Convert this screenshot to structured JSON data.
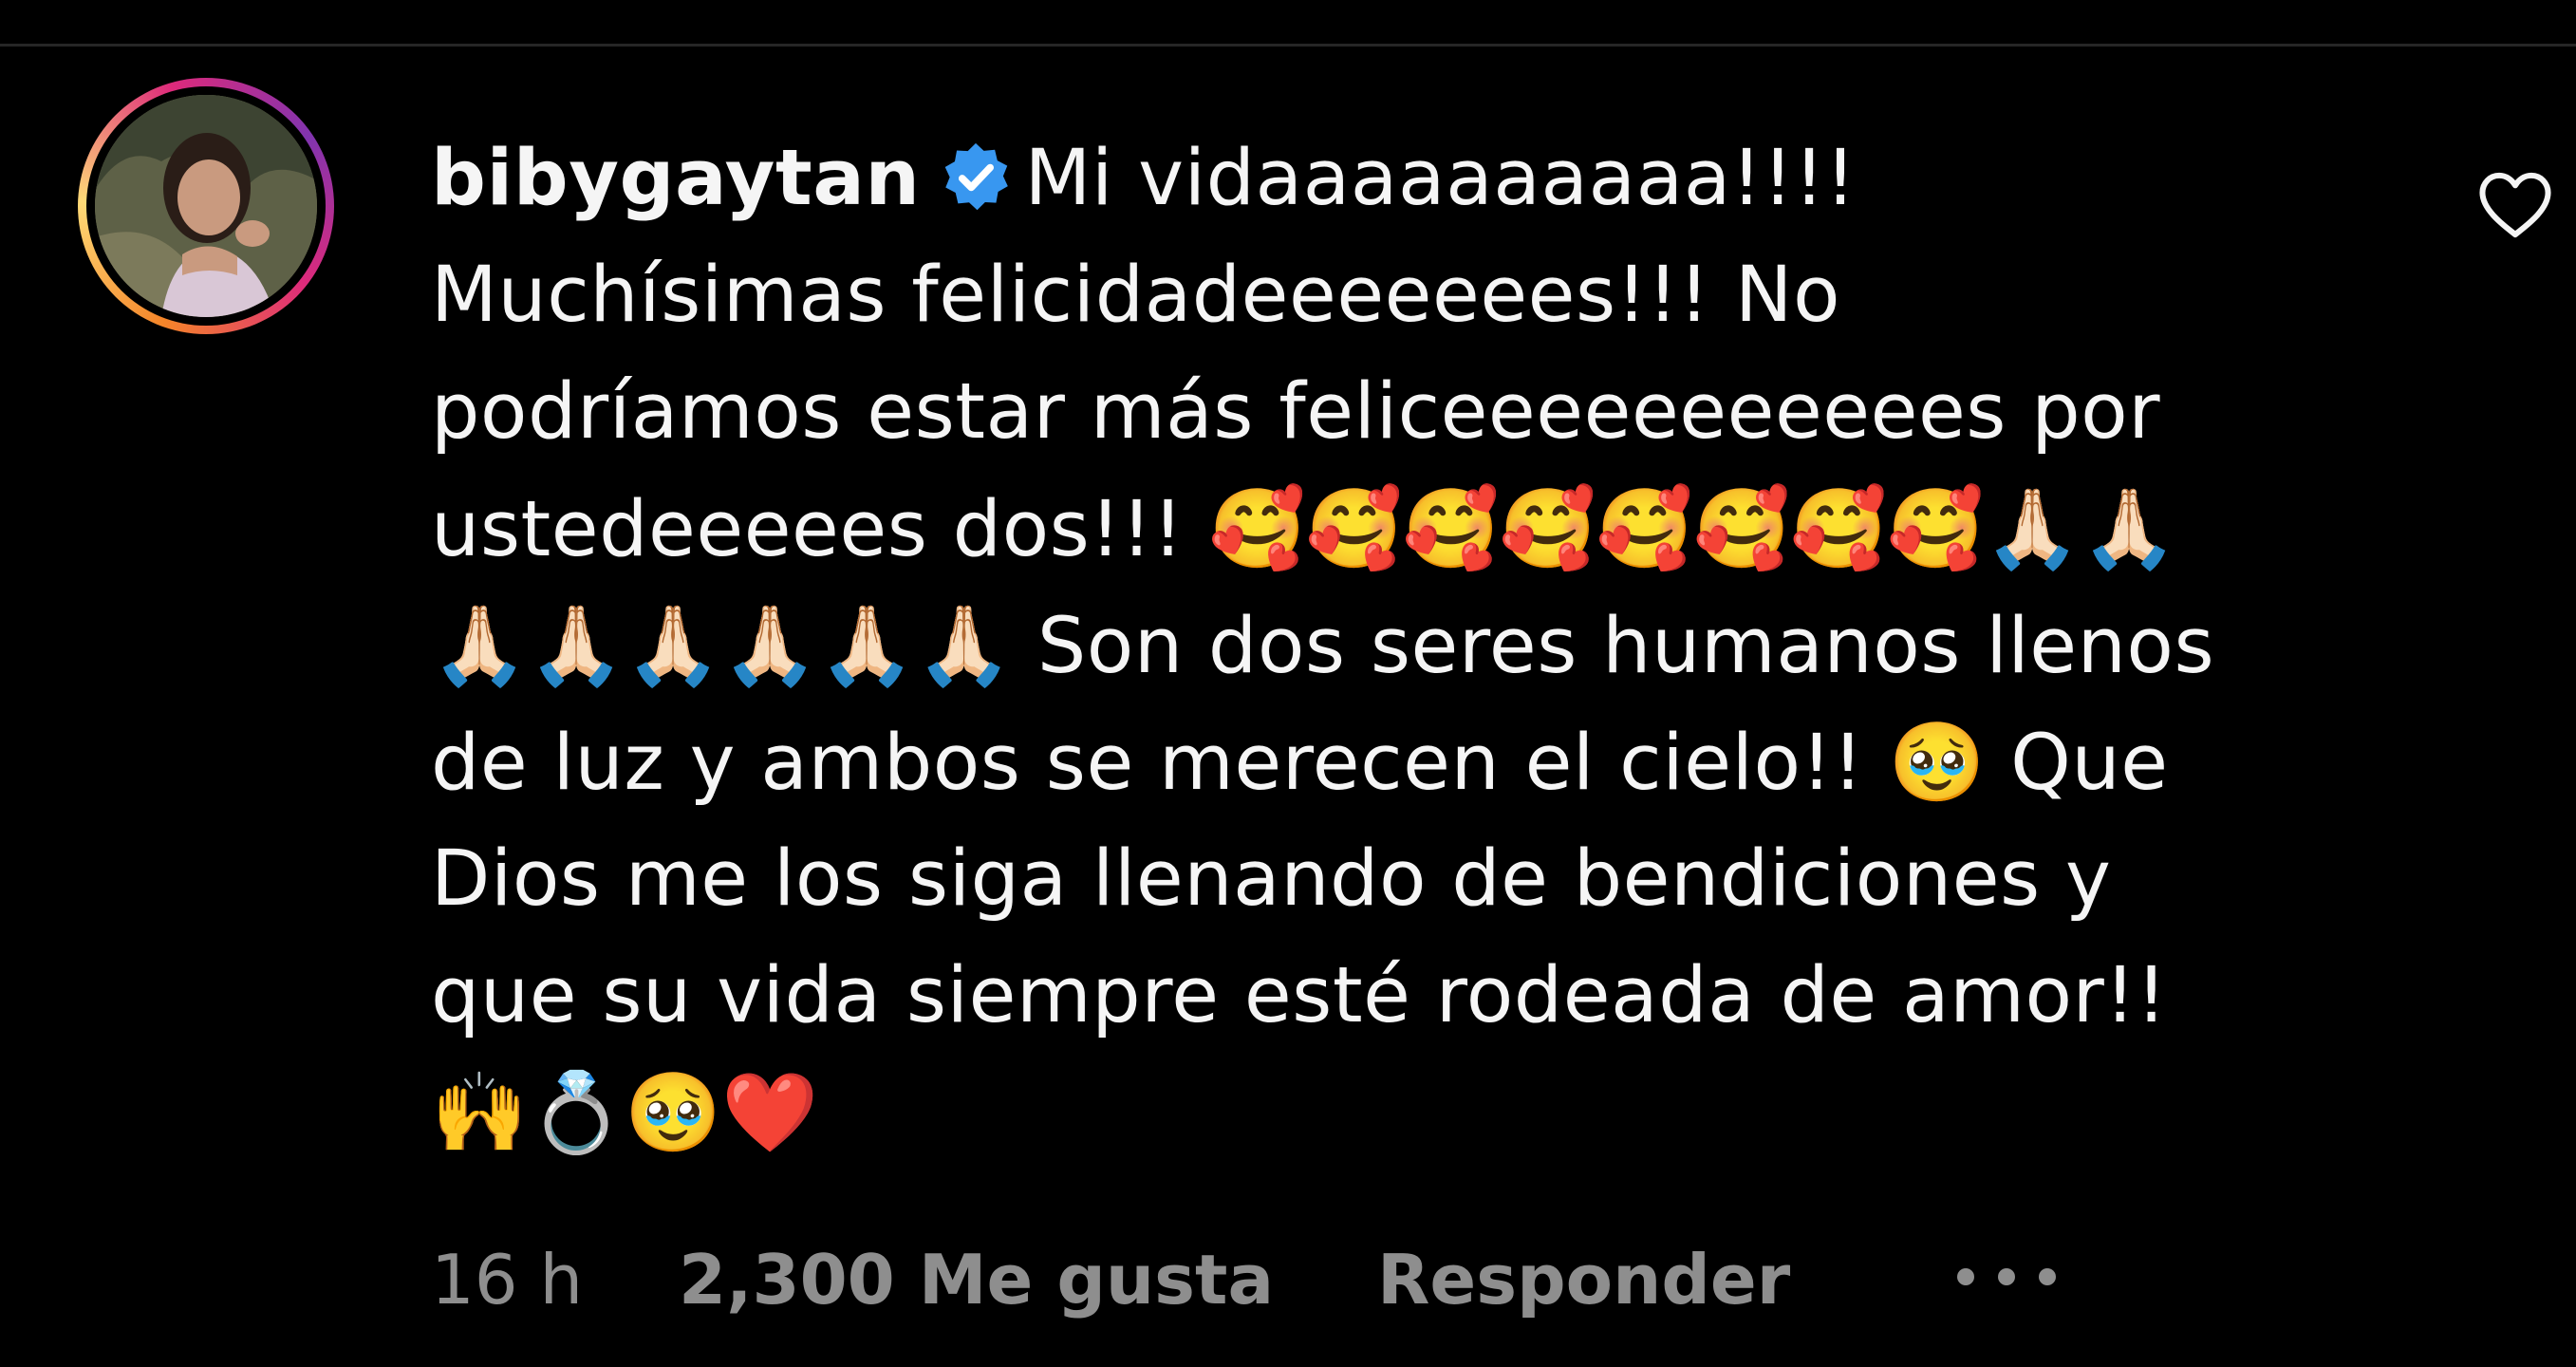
{
  "comment": {
    "avatar_icon": "profile-photo",
    "username": "bibygaytan",
    "verified_icon": "verified-badge-icon",
    "lines": [
      "Mi vidaaaaaaaaaa!!!!",
      "Muchísimas felicidadeeeeeees!!! No",
      "podríamos estar más feliceeeeeeeeeees por",
      "ustedeeeees dos!!! ",
      " Son dos seres humanos llenos",
      "de luz y ambos se merecen el cielo!! ",
      " Que",
      "Dios me los siga llenando de bendiciones y",
      "que su vida siempre esté rodeada de amor!!"
    ],
    "emojis": {
      "line3": "🥰🥰🥰🥰🥰🥰🥰🥰🙏🏻🙏🏻",
      "line4": "🙏🏻🙏🏻🙏🏻🙏🏻🙏🏻🙏🏻",
      "line5": "🥹",
      "line8": "🙌💍🥹❤️"
    },
    "meta": {
      "time": "16 h",
      "likes": "2,300 Me gusta",
      "reply": "Responder",
      "more_icon": "more-options-icon"
    },
    "like_icon": "heart-outline-icon"
  },
  "colors": {
    "background": "#000000",
    "text": "#f5f5f5",
    "meta": "#8e8e8e",
    "verified": "#3897f0"
  }
}
